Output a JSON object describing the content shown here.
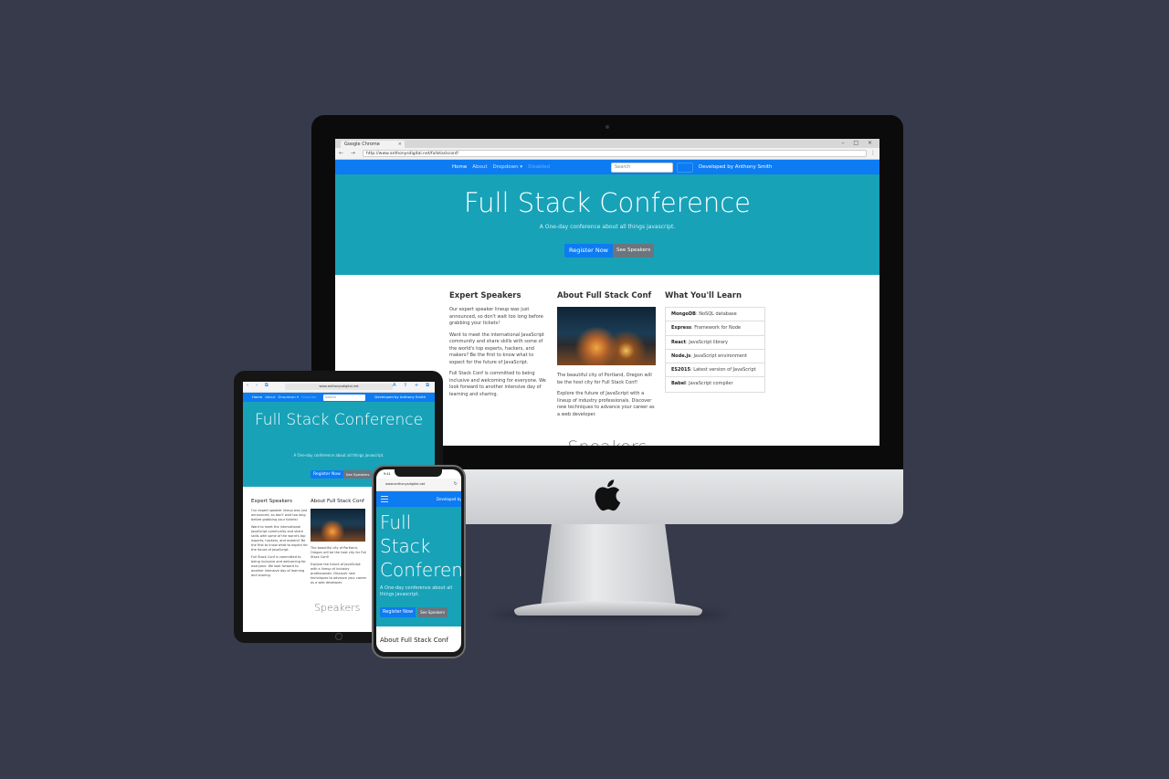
{
  "desktop": {
    "browser": {
      "tab_title": "Google Chrome",
      "tab_close": "×",
      "window_buttons": "– □ ×",
      "nav_buttons": "← → C",
      "url": "http://www.anthonysdigital.net/fullstackconf/",
      "menu": "⋮"
    },
    "nav": {
      "links": [
        "Home",
        "About",
        "Dropdown ▾",
        "Disabled"
      ],
      "search_placeholder": "Search",
      "brand": "Developed by Anthony Smith"
    },
    "hero": {
      "title": "Full Stack Conference",
      "subtitle": "A One-day conference about all things javascript.",
      "primary_button": "Register Now",
      "secondary_button": "See Speakers"
    },
    "columns": {
      "speakers": {
        "heading": "Expert Speakers",
        "paragraphs": [
          "Our expert speaker lineup was just announced, so don't wait too long before grabbing your tickets!",
          "Want to meet the international JavaScript community and share skills with some of the world's top experts, hackers, and makers? Be the first to know what to expect for the future of JavaScript.",
          "Full Stack Conf is committed to being inclusive and welcoming for everyone. We look forward to another intensive day of learning and sharing."
        ]
      },
      "about": {
        "heading": "About Full Stack Conf",
        "paragraphs": [
          "The beautiful city of Portland, Oregon will be the host city for Full Stack Conf!",
          "Explore the future of JavaScript with a lineup of industry professionals. Discover new techniques to advance your career as a web developer."
        ]
      },
      "learn": {
        "heading": "What You'll Learn",
        "items": [
          {
            "name": "MongoDB",
            "desc": ": NoSQL database"
          },
          {
            "name": "Express",
            "desc": ": Framework for Node"
          },
          {
            "name": "React",
            "desc": ": JavaScript library"
          },
          {
            "name": "Node.js",
            "desc": ": JavaScript environment"
          },
          {
            "name": "ES2015",
            "desc": ": Latest version of JavaScript"
          },
          {
            "name": "Babel",
            "desc": ": JavaScript compiler"
          }
        ]
      }
    },
    "speakers_heading": "Speakers"
  },
  "tablet": {
    "nav_buttons": "‹ › ⧉",
    "url": "www.anthonysdigital.net",
    "tools": "A ⇧ + ⧉",
    "nav_links": [
      "Home",
      "About",
      "Dropdown ▾",
      "Disabled"
    ],
    "search_placeholder": "Search",
    "brand": "Developed by Anthony Smith",
    "hero_title": "Full Stack Conference",
    "hero_subtitle": "A One-day conference about all things javascript.",
    "primary_button": "Register Now",
    "secondary_button": "See Speakers",
    "speakers_col": {
      "heading": "Expert Speakers",
      "paragraphs": [
        "Our expert speaker lineup was just announced, so don't wait too long before grabbing your tickets!",
        "Want to meet the international JavaScript community and share skills with some of the world's top experts, hackers, and makers? Be the first to know what to expect for the future of JavaScript.",
        "Full Stack Conf is committed to being inclusive and welcoming for everyone. We look forward to another intensive day of learning and sharing."
      ]
    },
    "about_col": {
      "heading": "About Full Stack Conf",
      "paragraphs": [
        "The beautiful city of Portland, Oregon will be the host city for Full Stack Conf!",
        "Explore the future of JavaScript with a lineup of industry professionals. Discover new techniques to advance your career as a web developer."
      ]
    },
    "speakers_heading": "Speakers"
  },
  "phone": {
    "time": "9:41",
    "url": "www.anthonysdigital.net",
    "reload": "↻",
    "brand": "Developed by",
    "hero_title_lines": [
      "Full",
      "Stack",
      "Conference"
    ],
    "hero_subtitle": "A One-day conference about all things javascript.",
    "primary_button": "Register Now",
    "secondary_button": "See Speakers",
    "about_heading": "About Full Stack Conf"
  },
  "colors": {
    "background": "#363a4b",
    "primary": "#0d7bf2",
    "hero": "#17a2b8",
    "secondary": "#6c757d"
  }
}
